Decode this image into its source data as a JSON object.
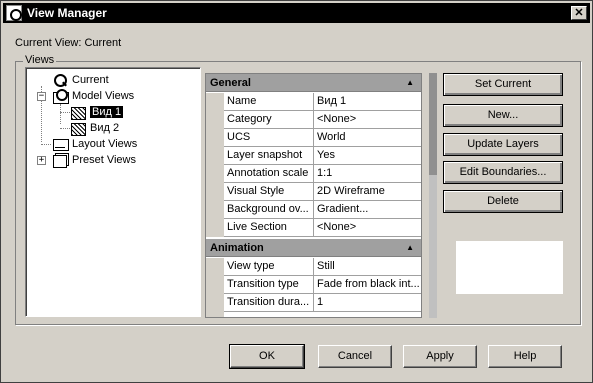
{
  "window": {
    "title": "View Manager",
    "close_glyph": "✕"
  },
  "current_view_label": "Current View: Current",
  "views_group_label": "Views",
  "tree": {
    "current": "Current",
    "model_views": "Model Views",
    "view1": "Вид 1",
    "view2": "Вид 2",
    "layout_views": "Layout Views",
    "preset_views": "Preset Views"
  },
  "properties": {
    "general": {
      "title": "General",
      "rows": [
        {
          "key": "Name",
          "value": "Вид 1"
        },
        {
          "key": "Category",
          "value": "<None>"
        },
        {
          "key": "UCS",
          "value": "World"
        },
        {
          "key": "Layer snapshot",
          "value": "Yes"
        },
        {
          "key": "Annotation scale",
          "value": "1:1"
        },
        {
          "key": "Visual Style",
          "value": "2D Wireframe"
        },
        {
          "key": "Background ov...",
          "value": "Gradient..."
        },
        {
          "key": "Live Section",
          "value": "<None>"
        }
      ]
    },
    "animation": {
      "title": "Animation",
      "rows": [
        {
          "key": "View type",
          "value": "Still"
        },
        {
          "key": "Transition type",
          "value": "Fade from black int..."
        },
        {
          "key": "Transition dura...",
          "value": "1"
        }
      ]
    }
  },
  "buttons": {
    "set_current": "Set Current",
    "new": "New...",
    "update_layers": "Update Layers",
    "edit_boundaries": "Edit Boundaries...",
    "delete": "Delete",
    "ok": "OK",
    "cancel": "Cancel",
    "apply": "Apply",
    "help": "Help"
  }
}
